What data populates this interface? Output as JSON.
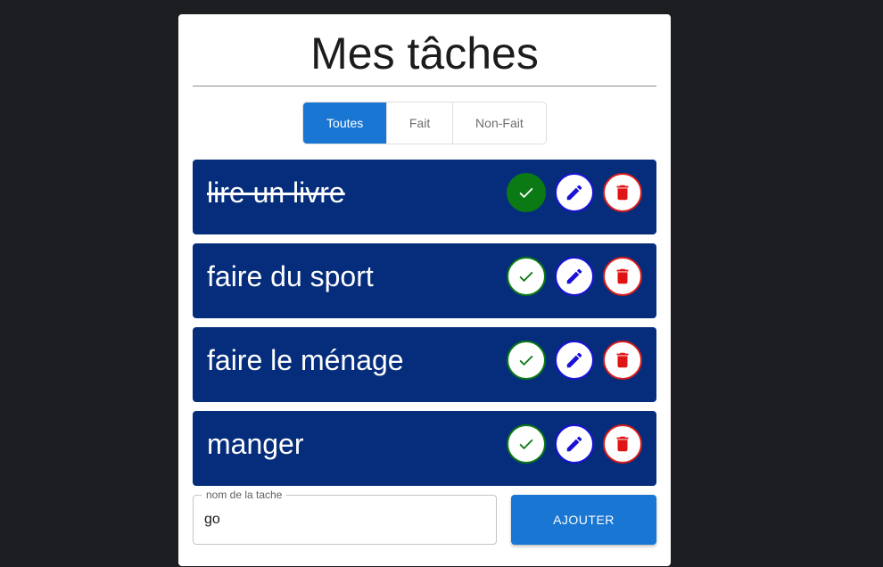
{
  "page": {
    "title": "Mes tâches"
  },
  "filters": [
    {
      "label": "Toutes",
      "active": true
    },
    {
      "label": "Fait",
      "active": false
    },
    {
      "label": "Non-Fait",
      "active": false
    }
  ],
  "tasks": [
    {
      "label": "lire un livre",
      "done": true
    },
    {
      "label": "faire du sport",
      "done": false
    },
    {
      "label": "faire le ménage",
      "done": false
    },
    {
      "label": "manger",
      "done": false
    }
  ],
  "task_actions": {
    "check_icon": "check-icon",
    "edit_icon": "pencil-icon",
    "delete_icon": "trash-icon"
  },
  "new_task": {
    "label": "nom de la tache",
    "value": "go"
  },
  "add_button": {
    "label": "AJOUTER"
  },
  "colors": {
    "background": "#1d1e21",
    "card": "#ffffff",
    "task_bg": "#052d7b",
    "primary": "#1976d2",
    "check": "#0b7a14",
    "edit": "#1a11d6",
    "delete": "#d81b1b"
  }
}
